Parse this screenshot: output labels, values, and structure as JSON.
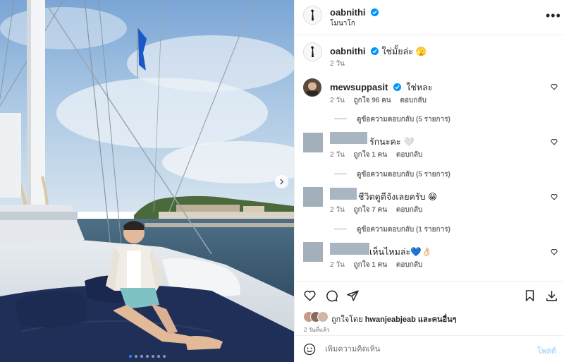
{
  "post": {
    "username": "oabnithi",
    "location": "โมนาโก",
    "image_count": 7,
    "active_image": 0
  },
  "caption": {
    "username": "oabnithi",
    "text": "ใช่มั้ยล่ะ 🫣",
    "time": "2 วัน"
  },
  "comments": [
    {
      "username": "mewsuppasit",
      "verified": true,
      "text": "ใช่หละ",
      "time": "2 วัน",
      "likes": "ถูกใจ 96 คน",
      "reply": "ตอบกลับ",
      "view_replies": "ดูข้อความตอบกลับ (5 รายการ)",
      "redacted": false
    },
    {
      "username": "",
      "verified": false,
      "text": "รักนะคะ 🤍",
      "time": "2 วัน",
      "likes": "ถูกใจ 1 คน",
      "reply": "ตอบกลับ",
      "view_replies": "ดูข้อความตอบกลับ (5 รายการ)",
      "redacted": true
    },
    {
      "username": "",
      "verified": false,
      "text": "ชีวิตดูดีจังเลยครับ 😁",
      "time": "2 วัน",
      "likes": "ถูกใจ 7 คน",
      "reply": "ตอบกลับ",
      "view_replies": "ดูข้อความตอบกลับ (1 รายการ)",
      "redacted": true
    },
    {
      "username": "",
      "verified": false,
      "text": "เห็นไหมล่ะ💙👌🏻",
      "time": "2 วัน",
      "likes": "ถูกใจ 1 คน",
      "reply": "ตอบกลับ",
      "view_replies": "",
      "redacted": true
    }
  ],
  "liked_by": {
    "prefix": "ถูกใจโดย",
    "user": "hwanjeabjeab",
    "suffix": "และคนอื่นๆ"
  },
  "posted_ago": "2 วันที่แล้ว",
  "comment_box": {
    "placeholder": "เพิ่มความคิดเห็น",
    "post_label": "โพสต์"
  },
  "colors": {
    "verified": "#0095f6",
    "active_dot": "#2b7fff",
    "post_button": "#b3dbff"
  },
  "icons": [
    "more-icon",
    "heart-icon",
    "comment-icon",
    "share-icon",
    "bookmark-icon",
    "download-icon",
    "emoji-icon",
    "chevron-right-icon"
  ]
}
